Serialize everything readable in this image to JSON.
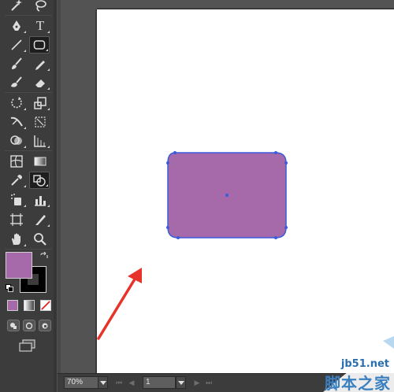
{
  "colors": {
    "fill": "#a66aab",
    "shape_fill": "#a66aab",
    "shape_stroke": "#3b5bdb",
    "arrow": "#e8332a",
    "canvas_bg": "#535353",
    "artboard": "#ffffff",
    "toolbar_bg": "#3c3c3c"
  },
  "tools": [
    {
      "name": "magic-wand-icon",
      "row": 1
    },
    {
      "name": "lasso-icon",
      "row": 1
    },
    {
      "name": "pen-tool-icon",
      "row": 2
    },
    {
      "name": "type-tool-icon",
      "row": 2,
      "label": "T"
    },
    {
      "name": "line-segment-tool-icon",
      "row": 3
    },
    {
      "name": "rounded-rectangle-tool-icon",
      "row": 3,
      "active": true
    },
    {
      "name": "paintbrush-tool-icon",
      "row": 4
    },
    {
      "name": "pencil-tool-icon",
      "row": 4
    },
    {
      "name": "blob-brush-tool-icon",
      "row": 5
    },
    {
      "name": "eraser-tool-icon",
      "row": 5
    },
    {
      "name": "rotate-tool-icon",
      "row": 6
    },
    {
      "name": "scale-tool-icon",
      "row": 6
    },
    {
      "name": "width-tool-icon",
      "row": 7
    },
    {
      "name": "free-transform-tool-icon",
      "row": 7
    },
    {
      "name": "shape-builder-tool-icon",
      "row": 8
    },
    {
      "name": "perspective-grid-tool-icon",
      "row": 8
    },
    {
      "name": "mesh-tool-icon",
      "row": 9
    },
    {
      "name": "gradient-tool-icon",
      "row": 9
    },
    {
      "name": "eyedropper-tool-icon",
      "row": 10
    },
    {
      "name": "blend-tool-icon",
      "row": 10,
      "active": true
    },
    {
      "name": "symbol-sprayer-tool-icon",
      "row": 11
    },
    {
      "name": "column-graph-tool-icon",
      "row": 11
    },
    {
      "name": "artboard-tool-icon",
      "row": 12
    },
    {
      "name": "slice-tool-icon",
      "row": 12
    },
    {
      "name": "hand-tool-icon",
      "row": 13
    },
    {
      "name": "zoom-tool-icon",
      "row": 13
    }
  ],
  "type_tool_label": "T",
  "statusbar": {
    "zoom": "70%",
    "page": "1"
  },
  "watermark": {
    "url": "jb51.net",
    "cn": "脚本之家"
  }
}
